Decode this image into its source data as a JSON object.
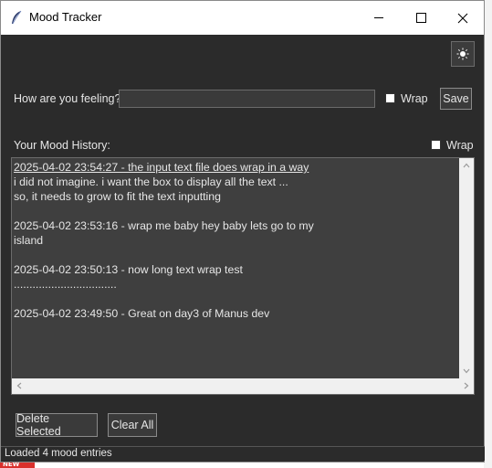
{
  "window": {
    "title": "Mood Tracker"
  },
  "toolbar": {
    "theme_icon": "sun-icon"
  },
  "input_row": {
    "prompt_label": "How are you feeling?",
    "input_value": "",
    "wrap_label": "Wrap",
    "save_label": "Save"
  },
  "history": {
    "heading": "Your Mood History:",
    "wrap_label": "Wrap",
    "entries": [
      {
        "lines": [
          "2025-04-02 23:54:27 - the input text file does wrap in a way",
          "i did not imagine. i want the box to display all the text ...",
          "so, it needs to grow to fit the text inputting"
        ]
      },
      {
        "lines": [
          "2025-04-02 23:53:16 - wrap me baby hey baby lets go to my",
          "island"
        ]
      },
      {
        "lines": [
          "2025-04-02 23:50:13 - now long text wrap test",
          "................................."
        ]
      },
      {
        "lines": [
          "2025-04-02 23:49:50 - Great on day3 of Manus dev"
        ]
      }
    ]
  },
  "actions": {
    "delete_label": "Delete Selected",
    "clear_label": "Clear All"
  },
  "status": {
    "text": "Loaded 4 mood entries"
  },
  "background": {
    "badge": "NEW"
  }
}
